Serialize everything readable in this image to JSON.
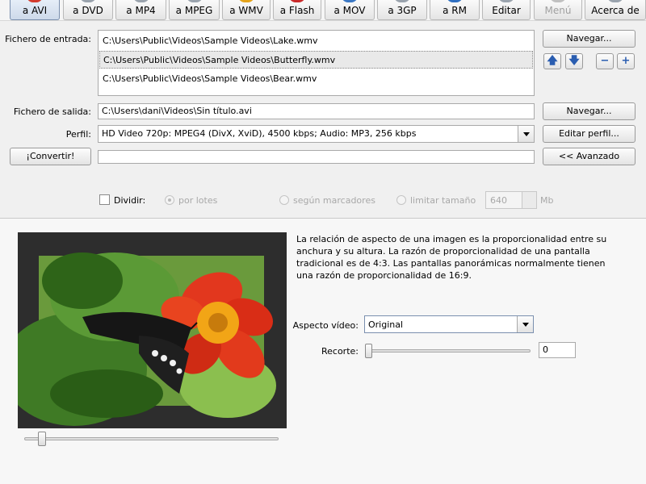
{
  "toolbar": {
    "items": [
      {
        "label": "a AVI",
        "icon": "avi-icon",
        "color": "#d33a2c"
      },
      {
        "label": "a DVD",
        "icon": "dvd-icon",
        "color": "#9aa3ad"
      },
      {
        "label": "a MP4",
        "icon": "mp4-icon",
        "color": "#9aa3ad"
      },
      {
        "label": "a MPEG",
        "icon": "mpeg-icon",
        "color": "#9aa3ad"
      },
      {
        "label": "a WMV",
        "icon": "wmv-icon",
        "color": "#e5a41b"
      },
      {
        "label": "a Flash",
        "icon": "flash-icon",
        "color": "#c92a2a"
      },
      {
        "label": "a MOV",
        "icon": "mov-icon",
        "color": "#3b78c4"
      },
      {
        "label": "a 3GP",
        "icon": "3gp-icon",
        "color": "#9aa3ad"
      },
      {
        "label": "a RM",
        "icon": "rm-icon",
        "color": "#2f6fc1"
      },
      {
        "label": "Editar",
        "icon": "edit-icon",
        "color": "#9aa3ad"
      },
      {
        "label": "Menú",
        "icon": "menu-icon",
        "color": "#c0c0c0"
      },
      {
        "label": "Acerca de",
        "icon": "about-icon",
        "color": "#9aa3ad"
      }
    ]
  },
  "input": {
    "label": "Fichero de entrada:",
    "files": [
      "C:\\Users\\Public\\Videos\\Sample Videos\\Lake.wmv",
      "C:\\Users\\Public\\Videos\\Sample Videos\\Butterfly.wmv",
      "C:\\Users\\Public\\Videos\\Sample Videos\\Bear.wmv"
    ],
    "browse_label": "Navegar...",
    "up_glyph": "🡅",
    "down_glyph": "🡇",
    "remove_glyph": "−",
    "add_glyph": "+"
  },
  "output": {
    "label": "Fichero de salida:",
    "value": "C:\\Users\\dani\\Videos\\Sin título.avi",
    "browse_label": "Navegar..."
  },
  "profile": {
    "label": "Perfil:",
    "value": "HD Video 720p: MPEG4 (DivX, XviD), 4500 kbps; Audio: MP3, 256 kbps",
    "edit_label": "Editar perfil..."
  },
  "convert": {
    "label": "¡Convertir!",
    "advanced_label": "<< Avanzado"
  },
  "split": {
    "label": "Dividir:",
    "option_batches": "por lotes",
    "option_markers": "según marcadores",
    "option_size": "limitar tamaño",
    "size_value": "640",
    "size_unit": "Mb"
  },
  "aspect": {
    "description": "La relación de aspecto de una imagen es la proporcionalidad entre su anchura y su altura. La razón de proporcionalidad de una pantalla tradicional es de 4:3. Las pantallas panorámicas normalmente tienen una razón de proporcionalidad de 16:9.",
    "video_label": "Aspecto vídeo:",
    "video_value": "Original",
    "crop_label": "Recorte:",
    "crop_value": "0"
  }
}
